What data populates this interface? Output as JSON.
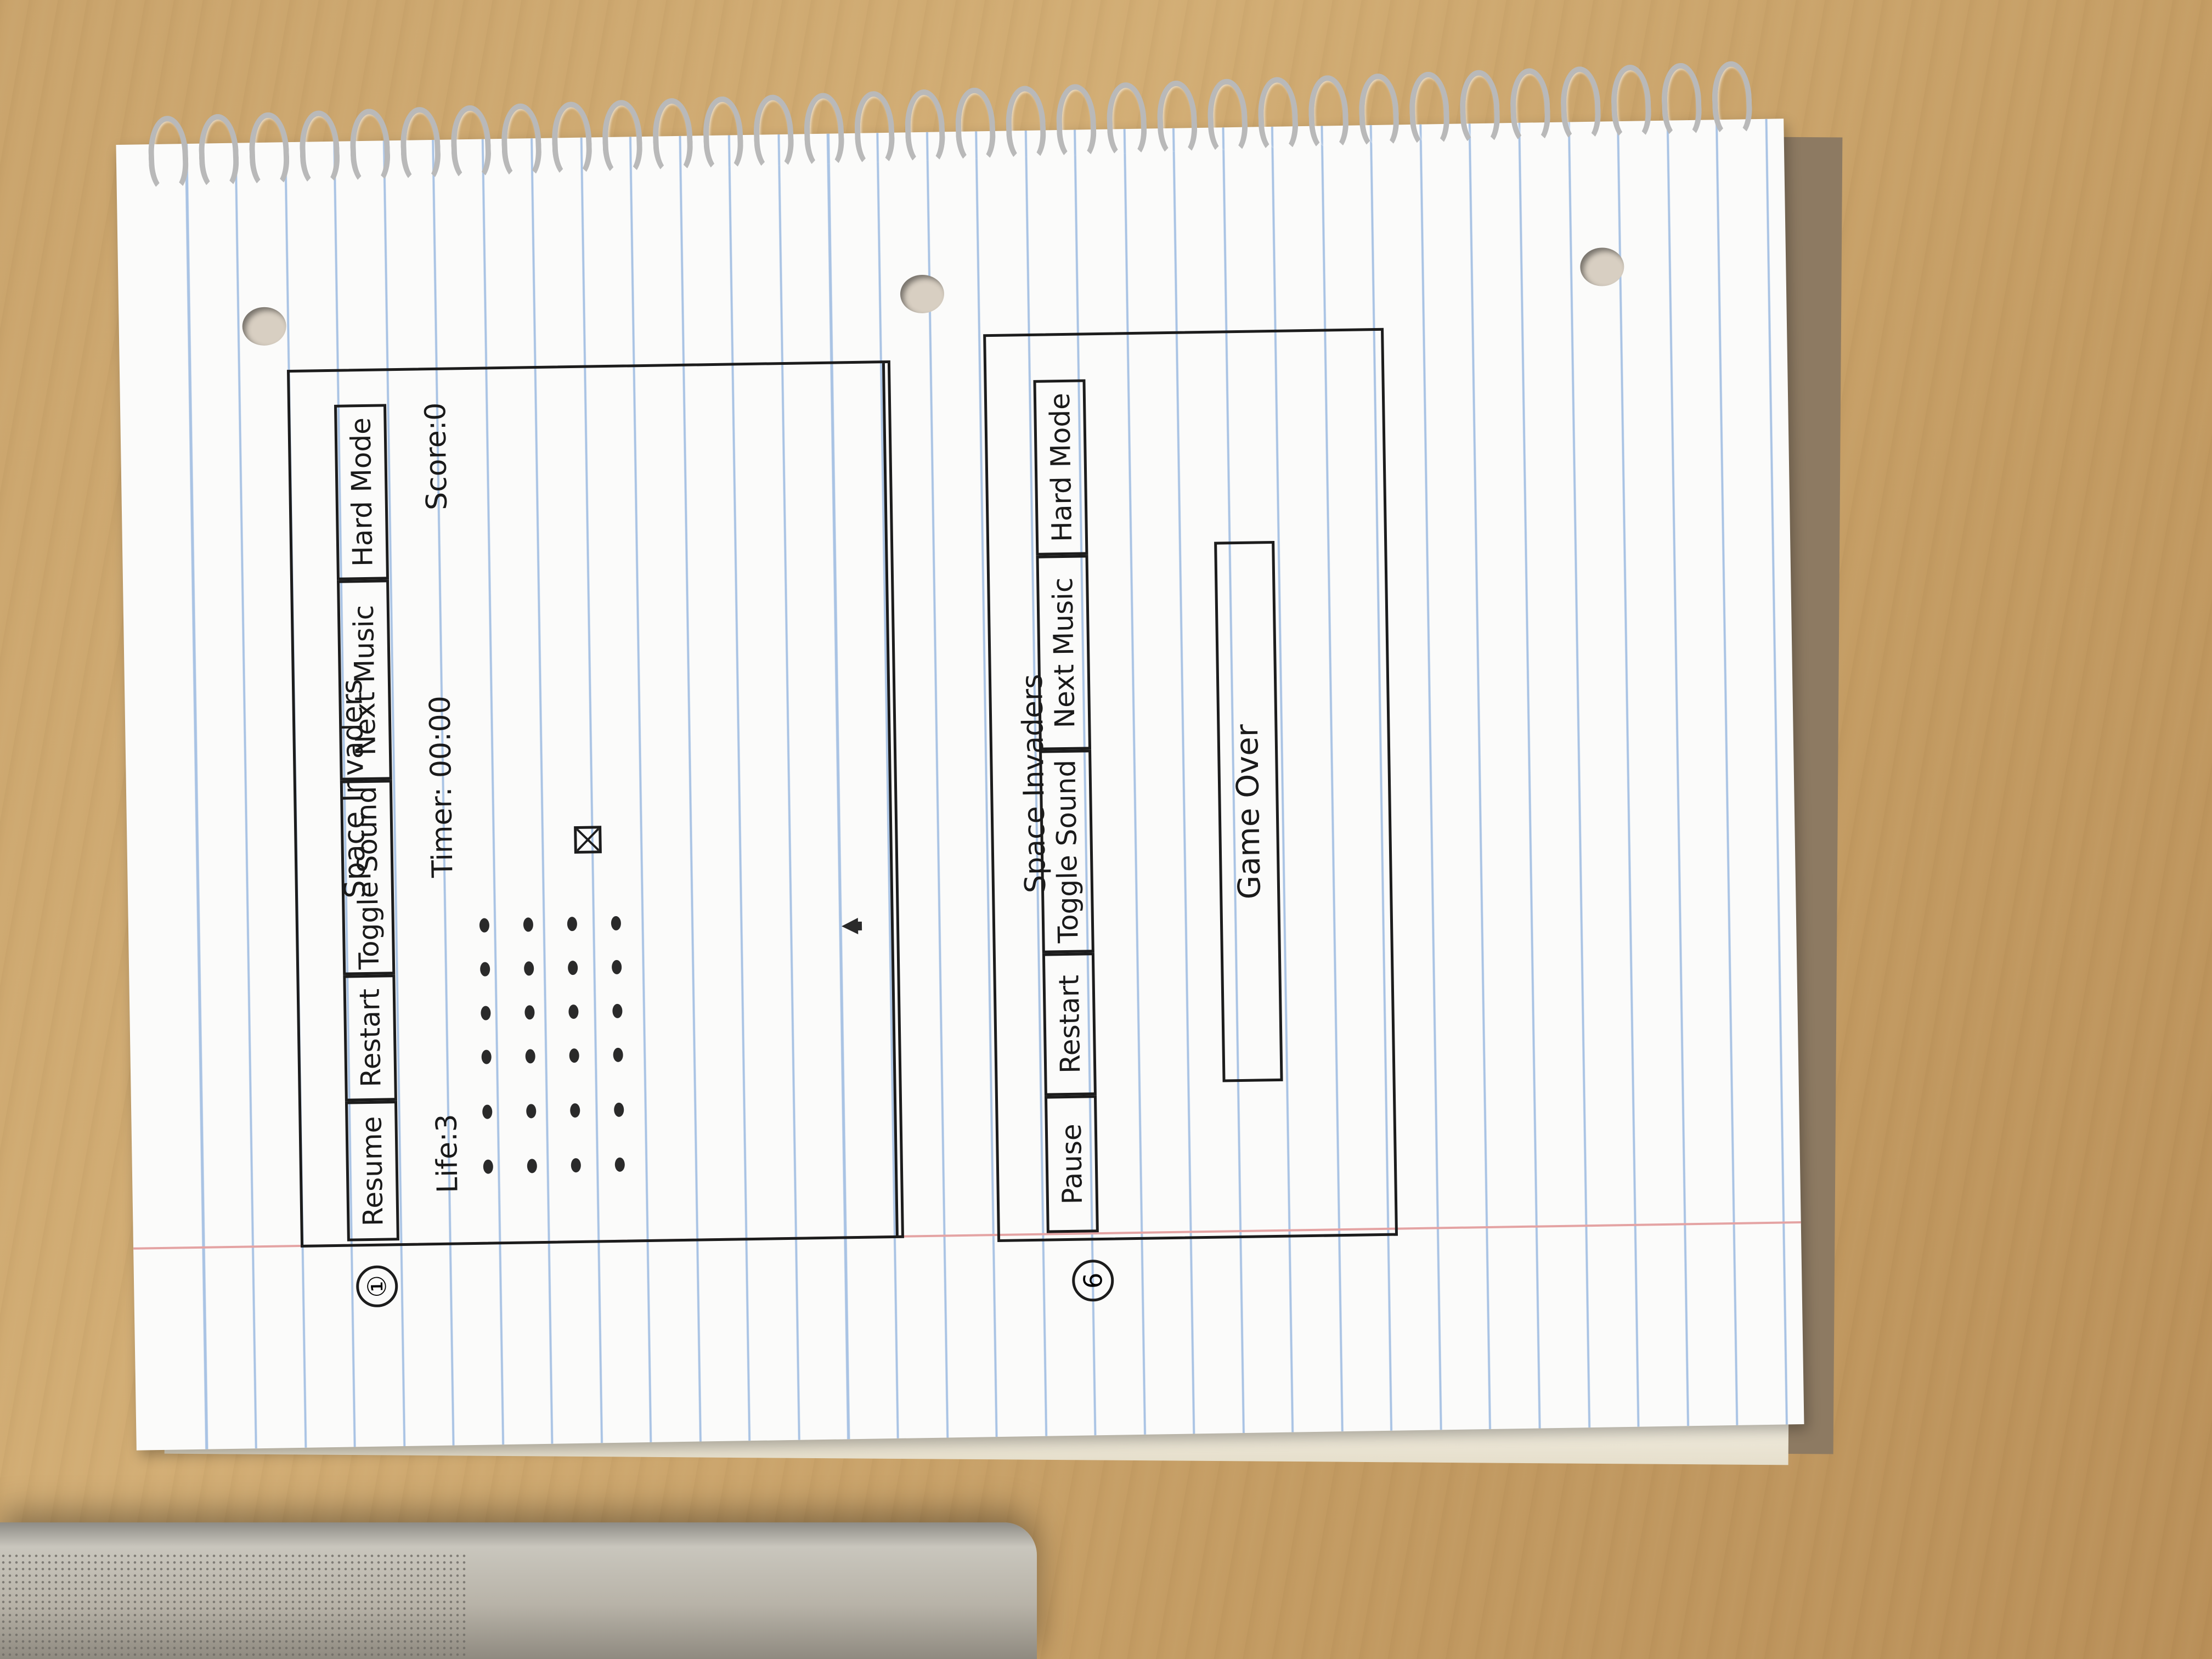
{
  "sketch_1": {
    "number": "①",
    "title": "Space Invaders",
    "buttons": [
      "Resume",
      "Restart",
      "Toggle Sound",
      "Next Music",
      "Hard Mode"
    ],
    "life": "Life:3",
    "timer": "Timer: 00:00",
    "score": "Score:0"
  },
  "sketch_2": {
    "number": "6",
    "title": "Space Invaders",
    "buttons": [
      "Pause",
      "Restart",
      "Toggle Sound",
      "Next Music",
      "Hard Mode"
    ],
    "message": "Game Over"
  },
  "colors": {
    "ink": "#1a1a1a",
    "ruling": "#a9c3e4",
    "margin": "#e4a3a3",
    "desk": "#c9a36b"
  }
}
